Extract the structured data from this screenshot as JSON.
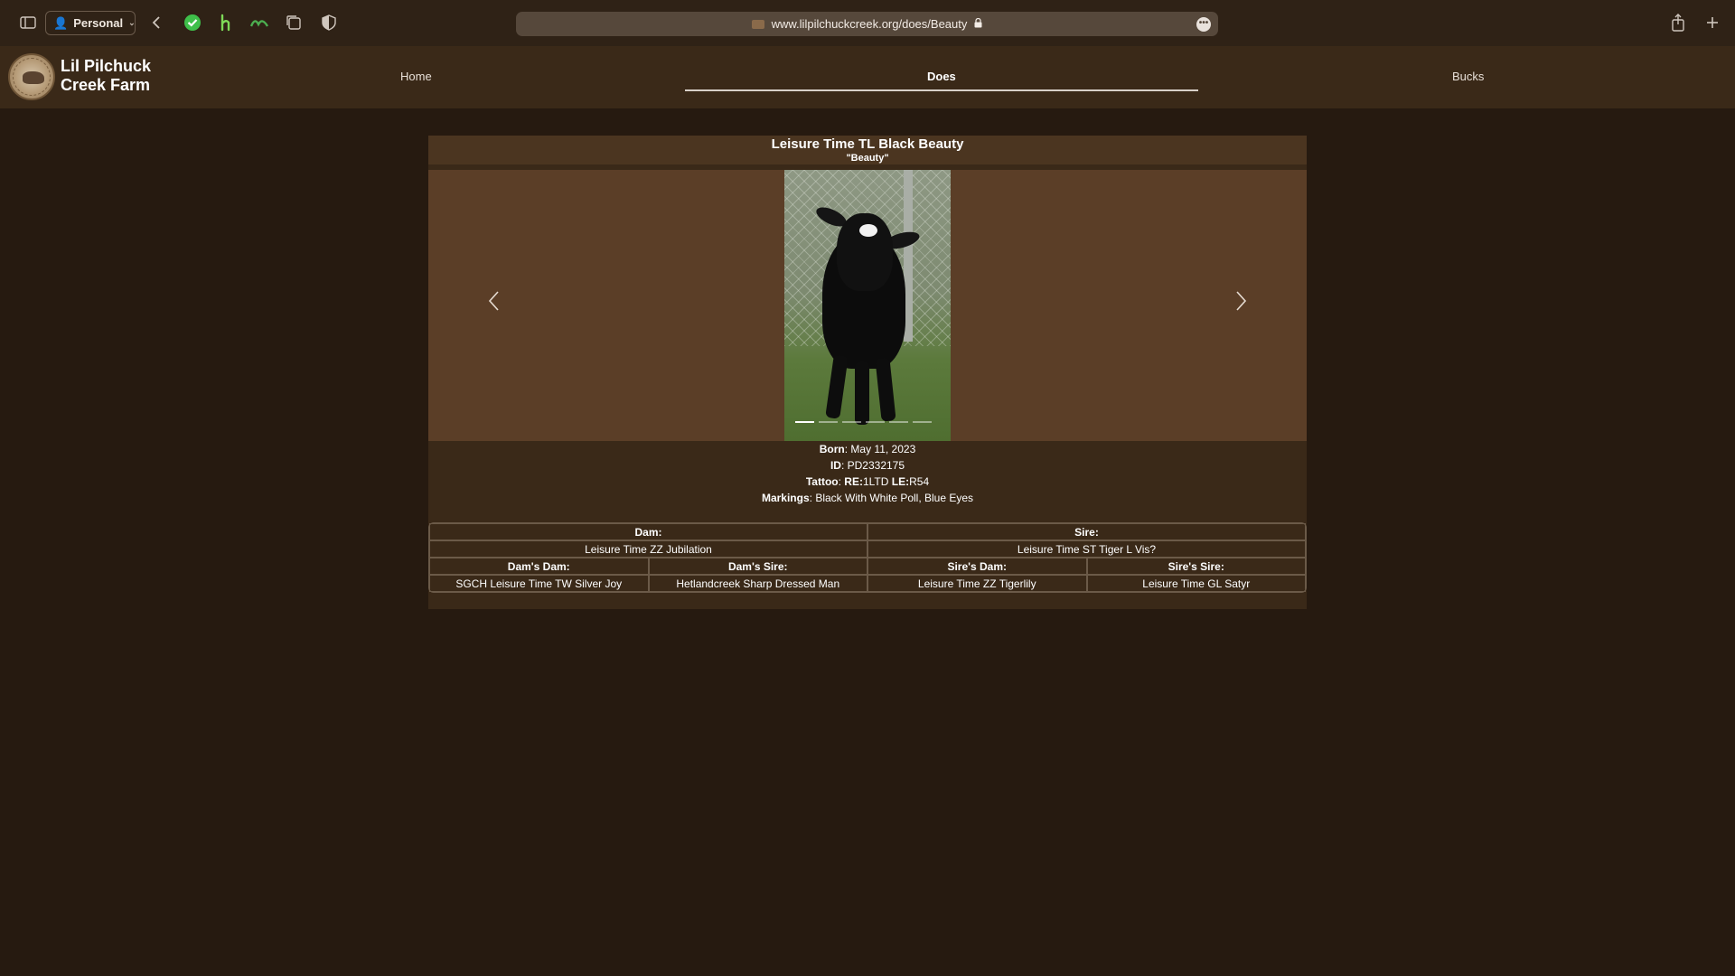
{
  "browser": {
    "profile_label": "Personal",
    "url": "www.lilpilchuckcreek.org/does/Beauty",
    "more_label": "•••"
  },
  "site": {
    "name": "Lil Pilchuck Creek Farm",
    "nav": [
      {
        "label": "Home",
        "active": false
      },
      {
        "label": "Does",
        "active": true
      },
      {
        "label": "Bucks",
        "active": false
      }
    ]
  },
  "goat": {
    "name": "Leisure Time TL Black Beauty",
    "nickname": "\"Beauty\"",
    "born_label": "Born",
    "born": "May 11, 2023",
    "id_label": "ID",
    "id": "PD2332175",
    "tattoo_label": "Tattoo",
    "tattoo_re_label": "RE:",
    "tattoo_re": "1LTD",
    "tattoo_le_label": "LE:",
    "tattoo_le": "R54",
    "markings_label": "Markings",
    "markings": "Black With White Poll, Blue Eyes"
  },
  "carousel": {
    "slide_count": 6,
    "active_slide": 1
  },
  "pedigree": {
    "dam_label": "Dam:",
    "dam": "Leisure Time ZZ Jubilation",
    "sire_label": "Sire:",
    "sire": "Leisure Time ST Tiger L Vis?",
    "dams_dam_label": "Dam's Dam:",
    "dams_dam": "SGCH Leisure Time TW Silver Joy",
    "dams_sire_label": "Dam's Sire:",
    "dams_sire": "Hetlandcreek Sharp Dressed Man",
    "sires_dam_label": "Sire's Dam:",
    "sires_dam": "Leisure Time ZZ Tigerlily",
    "sires_sire_label": "Sire's Sire:",
    "sires_sire": "Leisure Time GL Satyr"
  }
}
